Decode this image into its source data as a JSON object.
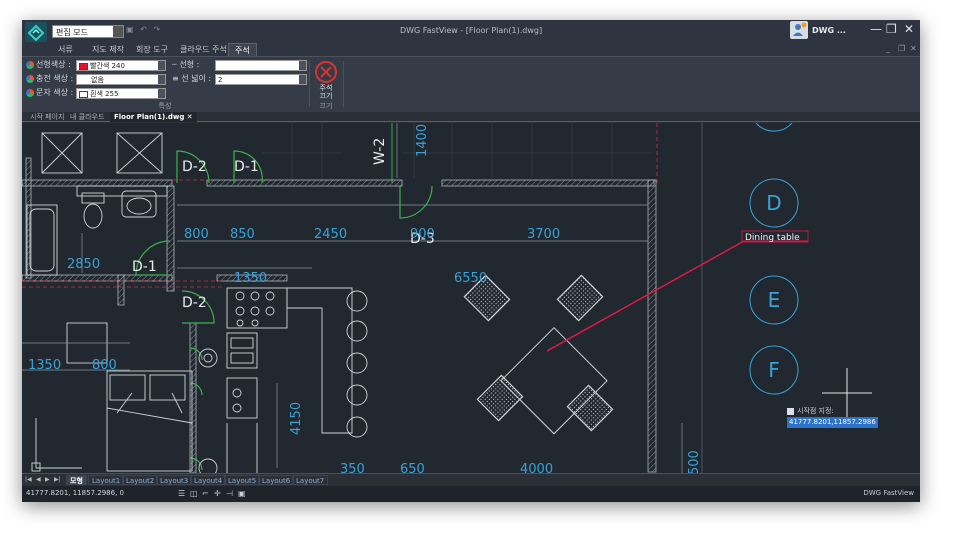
{
  "titlebar": {
    "mode": "편집 모드",
    "window_title": "DWG FastView - [Floor Plan(1).dwg]",
    "user_name": "DWG ...",
    "min": "—",
    "restore": "❐",
    "close": "✕"
  },
  "ribbon_tabs": [
    "서류",
    "지도 제작",
    "회장 도구",
    "클라우드 주석",
    "주석"
  ],
  "ribbon": {
    "line_color_label": "선형색상 :",
    "line_color_value": "빨간색 240",
    "fill_color_label": "충전 색상 :",
    "fill_color_value": "없음",
    "text_color_label": "문자 색상 :",
    "text_color_value": "흰색 255",
    "linetype_label": "선형 :",
    "lineweight_label": "선 넓이 :",
    "lineweight_value": "2",
    "group_props": "특성",
    "close_label_1": "주석",
    "close_label_2": "끄기",
    "group_close": "끄기",
    "colors": {
      "red": "#e8102e",
      "white": "#ffffff"
    }
  },
  "doc_tabs": [
    "시작 페이지",
    "내 클라우드",
    "Floor Plan(1).dwg"
  ],
  "drawing": {
    "room_labels": [
      "D-2",
      "D-1",
      "D-1",
      "D-2",
      "D-3",
      "W-2"
    ],
    "dims": [
      "800",
      "850",
      "2450",
      "900",
      "3700",
      "2850",
      "1350",
      "6550",
      "1350",
      "800",
      "1400",
      "4150",
      "350",
      "650",
      "4000",
      "500"
    ],
    "grid_labels": [
      "D",
      "E",
      "F"
    ],
    "annotation": "Dining table"
  },
  "command": {
    "prompt": "시작점 지정:",
    "input": "41777.8201,11857.2986"
  },
  "layout_tabs": [
    "모형",
    "Layout1",
    "Layout2",
    "Layout3",
    "Layout4",
    "Layout5",
    "Layout6",
    "Layout7"
  ],
  "status": {
    "coords": "41777.8201, 11857.2986, 0",
    "brand": "DWG FastView"
  }
}
